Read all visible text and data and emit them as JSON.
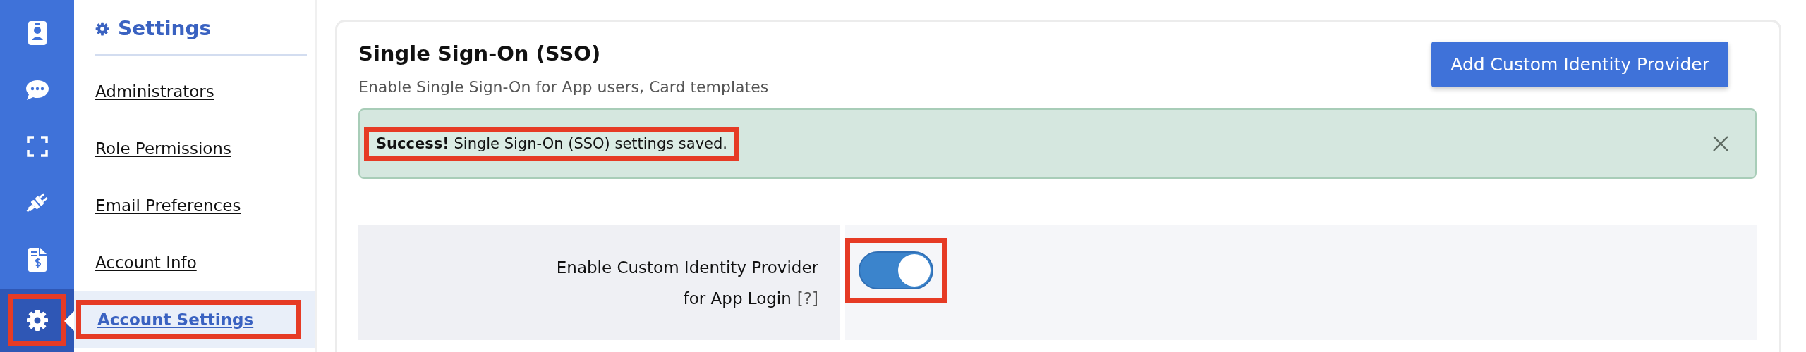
{
  "rail": [
    {
      "kind": "contact",
      "selected": false,
      "highlighted": false
    },
    {
      "kind": "chat",
      "selected": false,
      "highlighted": false
    },
    {
      "kind": "scan",
      "selected": false,
      "highlighted": false
    },
    {
      "kind": "plug",
      "selected": false,
      "highlighted": false
    },
    {
      "kind": "invoice",
      "selected": false,
      "highlighted": false
    },
    {
      "kind": "settings",
      "selected": true,
      "highlighted": true
    }
  ],
  "sidebar": {
    "title": "Settings",
    "items": [
      {
        "label": "Administrators",
        "selected": false,
        "highlighted": false
      },
      {
        "label": "Role Permissions",
        "selected": false,
        "highlighted": false
      },
      {
        "label": "Email Preferences",
        "selected": false,
        "highlighted": false
      },
      {
        "label": "Account Info",
        "selected": false,
        "highlighted": false
      },
      {
        "label": "Account Settings",
        "selected": true,
        "highlighted": true
      }
    ]
  },
  "page": {
    "title": "Single Sign-On (SSO)",
    "subtitle": "Enable Single Sign-On for App users, Card templates",
    "button": "Add Custom Identity Provider"
  },
  "alert": {
    "text": "**Success!** Single Sign-On (SSO) settings saved.",
    "highlighted": true
  },
  "setting": {
    "label_lines": [
      "Enable Custom Identity Provider",
      "for App Login"
    ],
    "help": "[?]",
    "on": true,
    "highlighted": true
  }
}
